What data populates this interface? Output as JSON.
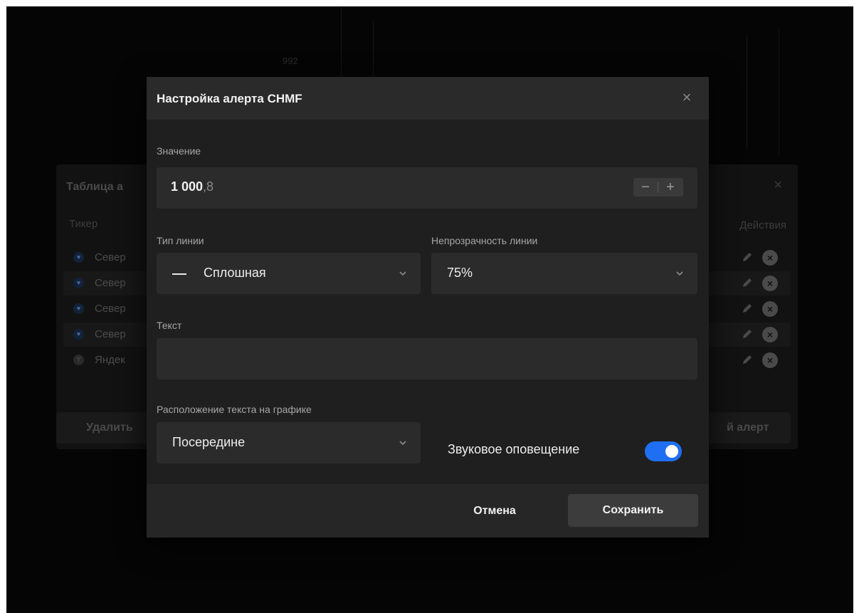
{
  "background": {
    "chart_label": "992",
    "panel": {
      "title": "Таблица а",
      "close": "×",
      "col_ticker": "Тикер",
      "col_actions": "Действия",
      "rows": [
        {
          "name": "Север",
          "icon": "♥"
        },
        {
          "name": "Север",
          "icon": "♥"
        },
        {
          "name": "Север",
          "icon": "♥"
        },
        {
          "name": "Север",
          "icon": "♥"
        },
        {
          "name": "Яндек",
          "icon": "Y"
        }
      ],
      "delete_label": "Удалить",
      "add_label": "й алерт"
    }
  },
  "modal": {
    "title": "Настройка алерта CHMF",
    "close_icon": "×",
    "value": {
      "label": "Значение",
      "integer": "1 000",
      "fraction": ",8",
      "minus": "−",
      "plus": "+"
    },
    "line_type": {
      "label": "Тип линии",
      "value": "Сплошная"
    },
    "line_opacity": {
      "label": "Непрозрачность линии",
      "value": "75%"
    },
    "text": {
      "label": "Текст",
      "value": ""
    },
    "text_position": {
      "label": "Расположение текста на графике",
      "value": "Посередине"
    },
    "sound": {
      "label": "Звуковое оповещение",
      "enabled": true
    },
    "cancel_label": "Отмена",
    "save_label": "Сохранить"
  },
  "colors": {
    "accent": "#1f6ff2",
    "modal_bg": "#1f1f1f",
    "input_bg": "#2b2b2b"
  }
}
